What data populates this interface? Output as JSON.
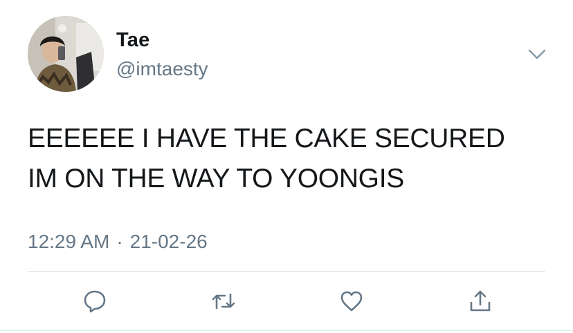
{
  "author": {
    "display_name": "Tae",
    "handle": "@imtaesty",
    "avatar_icon": "user-avatar-photo"
  },
  "tweet": {
    "lines": [
      "EEEEEE I HAVE THE CAKE SECURED",
      "IM ON THE WAY TO YOONGIS"
    ],
    "time": "12:29 AM",
    "separator": "·",
    "date": "21-02-26"
  },
  "actions": [
    {
      "name": "reply",
      "icon": "speech-bubble-icon"
    },
    {
      "name": "retweet",
      "icon": "retweet-icon"
    },
    {
      "name": "like",
      "icon": "heart-icon"
    },
    {
      "name": "share",
      "icon": "share-icon"
    }
  ],
  "colors": {
    "text": "#14171a",
    "secondary": "#657786",
    "divider": "#ccd6dd"
  }
}
